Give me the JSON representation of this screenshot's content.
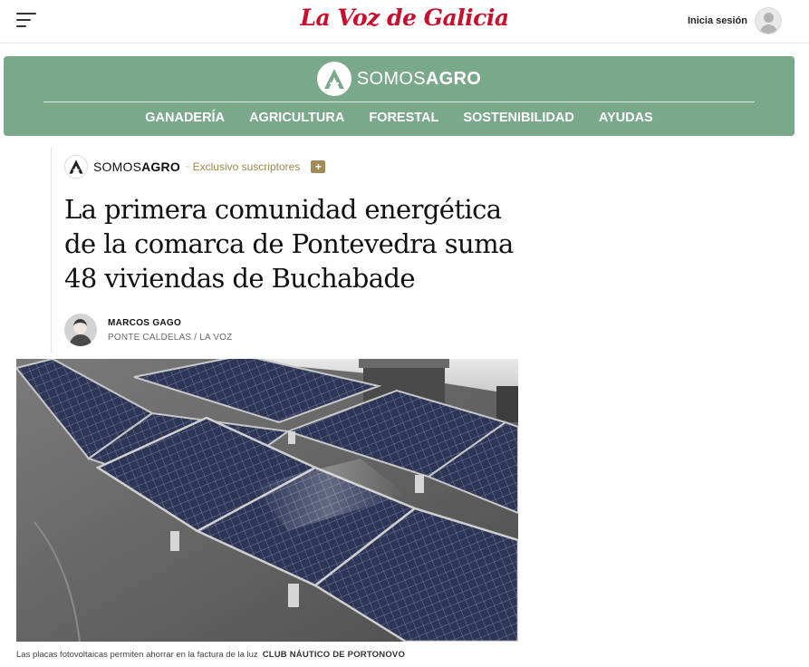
{
  "header": {
    "brand": "La Voz de Galicia",
    "login_label": "Inicia sesión",
    "icons": {
      "menu": "hamburger-menu-icon",
      "user": "user-avatar-icon"
    }
  },
  "section": {
    "logo_prefix": "SOMOS",
    "logo_suffix": "AGRO",
    "color": "#7aa88a",
    "nav": [
      "GANADERÍA",
      "AGRICULTURA",
      "FORESTAL",
      "SOSTENIBILIDAD",
      "AYUDAS"
    ]
  },
  "article": {
    "kicker_prefix": "SOMOS",
    "kicker_suffix": "AGRO",
    "kicker_separator": "·",
    "exclusive_label": "Exclusivo suscriptores",
    "exclusive_badge": "+",
    "headline": "La primera comunidad energética de la comarca de Pontevedra suma 48 viviendas de Buchabade",
    "author": "MARCOS GAGO",
    "location": "PONTE CALDELAS / LA VOZ",
    "caption": "Las placas fotovoltaicas permiten ahorrar en la factura de la luz",
    "credit": "CLUB NÁUTICO DE PORTONOVO",
    "accent_color": "#9a8a4e"
  }
}
